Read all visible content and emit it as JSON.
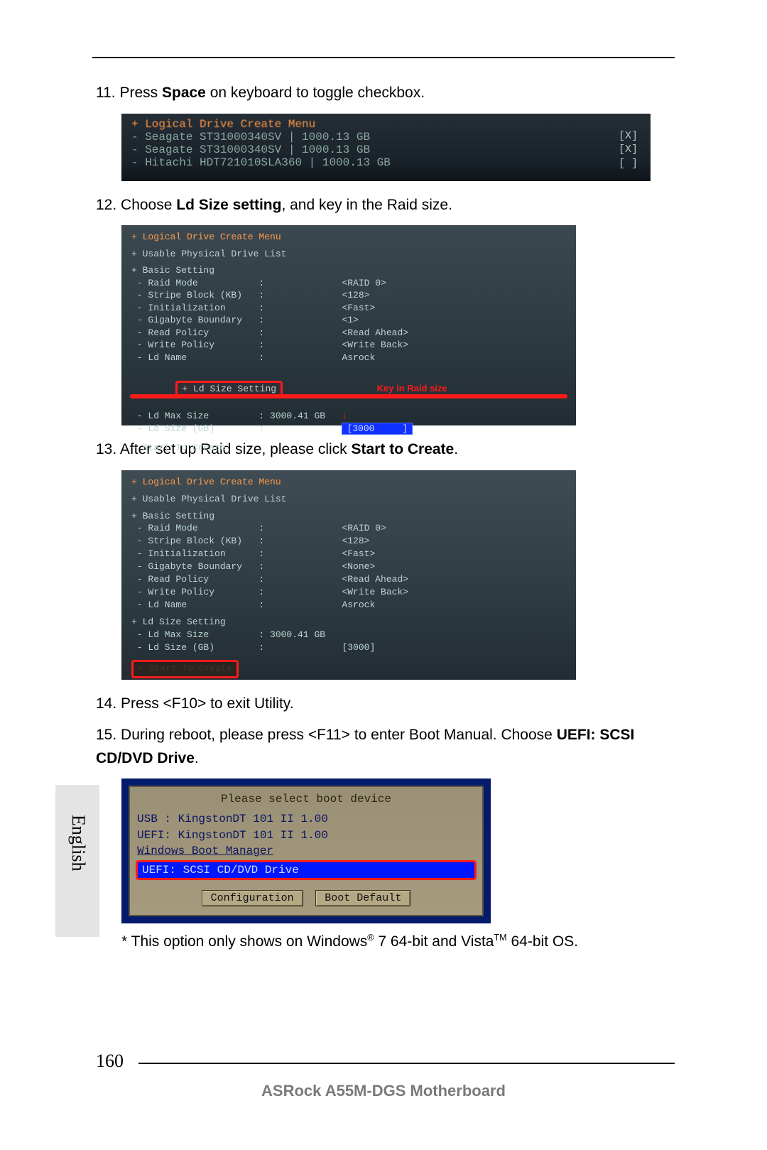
{
  "language_tab": "English",
  "page_number": "160",
  "footer": "ASRock  A55M-DGS  Motherboard",
  "steps": {
    "s11_num": "11. ",
    "s11_a": "Press ",
    "s11_b": "Space",
    "s11_c": " on keyboard to toggle checkbox.",
    "s12_num": "12. ",
    "s12_a": "Choose ",
    "s12_b": "Ld Size setting",
    "s12_c": ", and key in the Raid size.",
    "s13_num": "13. ",
    "s13_a": "After set up Raid size, please click ",
    "s13_b": "Start to Create",
    "s13_c": ".",
    "s14_num": "14. ",
    "s14_a": "Press <F10> to exit Utility.",
    "s15_num": "15. ",
    "s15_a": "During reboot, please press <F11> to enter Boot Manual. Choose ",
    "s15_b": "UEFI: SCSI CD/DVD Drive",
    "s15_c": ".",
    "note_a": "* This option only shows on Windows",
    "note_b": " 7 64-bit and Vista",
    "note_c": " 64-bit OS."
  },
  "shot1": {
    "title": "+ Logical Drive Create Menu",
    "r1": " - Seagate ST31000340SV       | 1000.13 GB",
    "r2": " - Seagate ST31000340SV       | 1000.13 GB",
    "r3": " - Hitachi HDT721010SLA360    | 1000.13 GB",
    "ch1": "[X]",
    "ch2": "[X]",
    "ch3": "[ ]"
  },
  "shot2": {
    "l0": "+ Logical Drive Create Menu",
    "l1": "+ Usable Physical Drive List",
    "l2": "+ Basic Setting",
    "l3": " - Raid Mode           :              <RAID 0>",
    "l4": " - Stripe Block (KB)   :              <128>",
    "l5": " - Initialization      :              <Fast>",
    "l6": " - Gigabyte Boundary   :              <1>",
    "l7": " - Read Policy         :              <Read Ahead>",
    "l8": " - Write Policy        :              <Write Back>",
    "l9": " - Ld Name             :              Asrock",
    "ld_setting": "+ Ld Size Setting",
    "keyin": "Key in Raid size",
    "l10": " - Ld Max Size         : 3000.41 GB",
    "l11_label": " - Ld Size (GB)        :              ",
    "l11_val": "[3000     ]",
    "l12": "+ Start To Create"
  },
  "shot3": {
    "l0": "+ Logical Drive Create Menu",
    "l1": "+ Usable Physical Drive List",
    "l2": "+ Basic Setting",
    "l3": " - Raid Mode           :              <RAID 0>",
    "l4": " - Stripe Block (KB)   :              <128>",
    "l5": " - Initialization      :              <Fast>",
    "l6": " - Gigabyte Boundary   :              <None>",
    "l7": " - Read Policy         :              <Read Ahead>",
    "l8": " - Write Policy        :              <Write Back>",
    "l9": " - Ld Name             :              Asrock",
    "l10": "+ Ld Size Setting",
    "l11": " - Ld Max Size         : 3000.41 GB",
    "l12": " - Ld Size (GB)        :              [3000]",
    "start": "+ Start To Create"
  },
  "shot4": {
    "title": "Please select boot device",
    "o1": "USB : KingstonDT 101 II 1.00",
    "o2": "UEFI: KingstonDT 101 II 1.00",
    "o3": "Windows Boot Manager",
    "sel": "UEFI: SCSI CD/DVD Drive",
    "btn1": "Configuration",
    "btn2": "Boot Default"
  }
}
